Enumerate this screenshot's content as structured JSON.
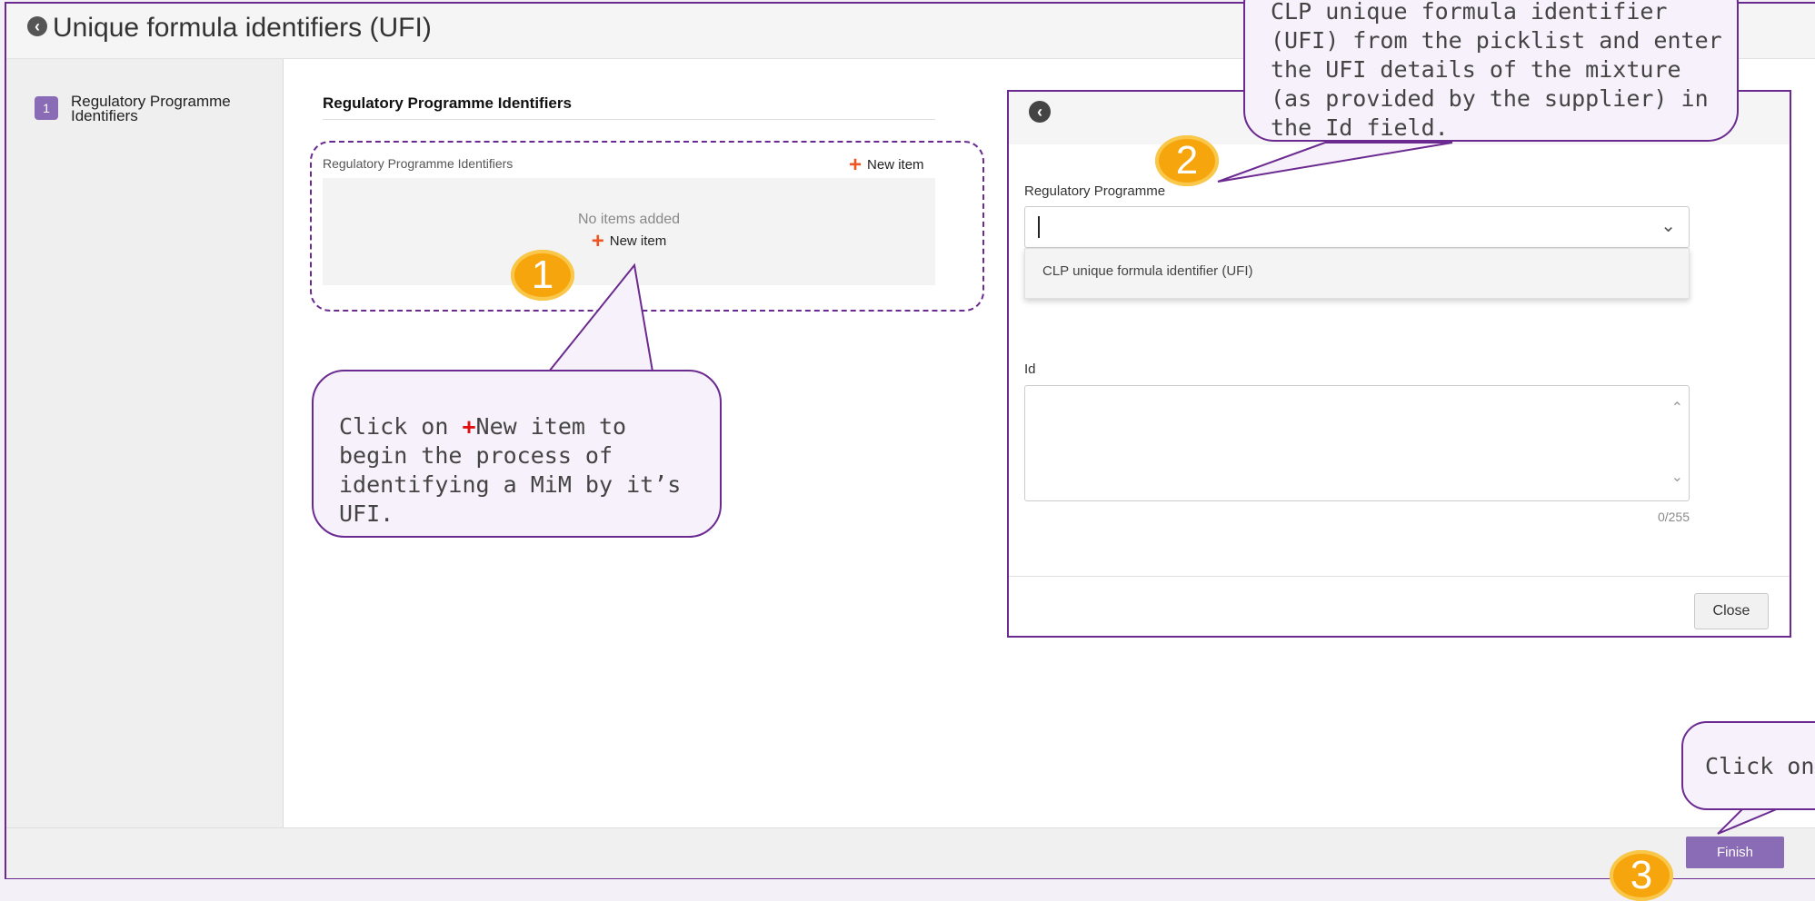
{
  "window": {
    "title": "Unique formula identifiers (UFI)"
  },
  "sidebar": {
    "items": [
      {
        "number": "1",
        "label": "Regulatory Programme Identifiers"
      }
    ]
  },
  "main": {
    "section_title": "Regulatory Programme Identifiers",
    "panel_label": "Regulatory Programme Identifiers",
    "new_item_label": "New item",
    "empty_text": "No items added"
  },
  "dialog": {
    "regulatory_programme_label": "Regulatory Programme",
    "dropdown_option": "CLP unique formula identifier (UFI)",
    "id_label": "Id",
    "char_counter": "0/255",
    "close_label": "Close"
  },
  "footer": {
    "finish_label": "Finish"
  },
  "callouts": {
    "c1_prefix": "Click on ",
    "c1_plus": "+",
    "c1_rest": "New item to begin the process of identifying a MiM by it’s UFI.",
    "c2_text": "CLP unique formula identifier (UFI) from the picklist and enter the UFI details of the mixture (as provided by the supplier) in the Id field.",
    "c3_text": "Click on F"
  },
  "badges": {
    "b1": "1",
    "b2": "2",
    "b3": "3"
  },
  "colors": {
    "accent": "#6b2a8f",
    "button": "#8a6bb5",
    "plus": "#ee5522",
    "badge": "#f7a50c"
  }
}
